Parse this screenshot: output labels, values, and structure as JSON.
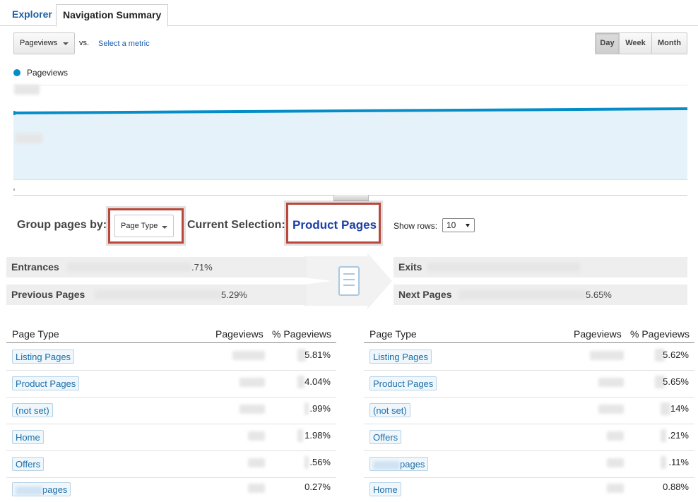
{
  "tabs": [
    {
      "label": "Explorer"
    },
    {
      "label": "Navigation Summary"
    }
  ],
  "metric": {
    "selected": "Pageviews",
    "vs_label": "vs.",
    "compare_link": "Select a metric"
  },
  "periods": [
    "Day",
    "Week",
    "Month"
  ],
  "colors": {
    "series": "#058dc7",
    "highlight": "#b9473a",
    "link": "#1d3fa6"
  },
  "chart": {
    "legend": "Pageviews"
  },
  "group": {
    "label": "Group pages by:",
    "selected": "Page Type",
    "current_label": "Current Selection:",
    "current_value": "Product Pages",
    "show_rows_label": "Show rows:",
    "show_rows_value": "10"
  },
  "flow": {
    "entrances": {
      "label": "Entrances",
      "value": ".71%"
    },
    "previous": {
      "label": "Previous Pages",
      "value": "5.29%"
    },
    "exits": {
      "label": "Exits"
    },
    "next": {
      "label": "Next Pages",
      "value": "5.65%"
    }
  },
  "left_table": {
    "headers": [
      "Page Type",
      "Pageviews",
      "% Pageviews"
    ],
    "rows": [
      {
        "name": "Listing Pages",
        "pct": "5.81%"
      },
      {
        "name": "Product Pages",
        "pct": "4.04%"
      },
      {
        "name": "(not set)",
        "pct": ".99%"
      },
      {
        "name": "Home",
        "pct": "1.98%"
      },
      {
        "name": "Offers",
        "pct": ".56%"
      },
      {
        "name": "pages",
        "pct": "0.27%"
      }
    ]
  },
  "right_table": {
    "headers": [
      "Page Type",
      "Pageviews",
      "% Pageviews"
    ],
    "rows": [
      {
        "name": "Listing Pages",
        "pct": "5.62%"
      },
      {
        "name": "Product Pages",
        "pct": "5.65%"
      },
      {
        "name": "(not set)",
        "pct": "14%"
      },
      {
        "name": "Offers",
        "pct": ".21%"
      },
      {
        "name": "pages",
        "pct": ".11%"
      },
      {
        "name": "Home",
        "pct": "0.88%"
      }
    ]
  }
}
